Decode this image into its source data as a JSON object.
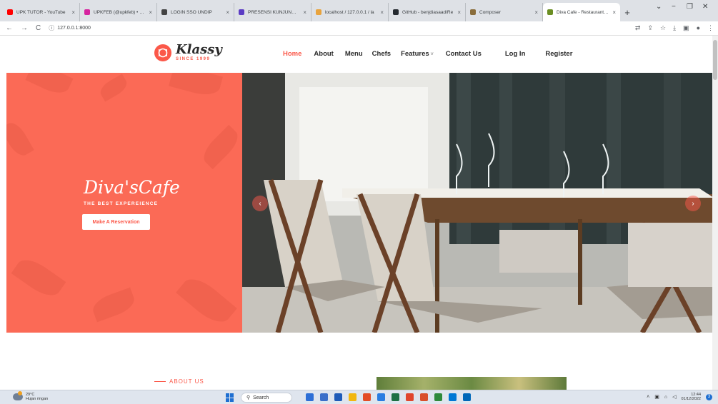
{
  "browser": {
    "tabs": [
      {
        "title": "UPK TUTOR - YouTube",
        "color": "#ff0000",
        "active": false
      },
      {
        "title": "UPKFEB (@upkfeb) • Foto",
        "color": "#d6249f",
        "active": false
      },
      {
        "title": "LOGIN SSO UNDIP",
        "color": "#444444",
        "active": false
      },
      {
        "title": "PRESENSI KUNJUNGAN",
        "color": "#5b3cc4",
        "active": false
      },
      {
        "title": "localhost / 127.0.0.1 / la",
        "color": "#e8a33d",
        "active": false
      },
      {
        "title": "GitHub - benjdiasaad/Re",
        "color": "#24292f",
        "active": false
      },
      {
        "title": "Composer",
        "color": "#8a6d3b",
        "active": false
      },
      {
        "title": "Diva Cafe - Restaurant HT",
        "color": "#6b8e23",
        "active": true
      }
    ],
    "new_tab": "+",
    "close_glyph": "×",
    "window_controls": {
      "dropdown": "⌄",
      "minimize": "−",
      "restore": "❐",
      "close": "✕"
    },
    "nav": {
      "back": "←",
      "forward": "→",
      "reload": "C",
      "info": "ⓘ"
    },
    "url": "127.0.0.1:8000",
    "right_icons": [
      "translate-icon",
      "share-icon",
      "star-icon",
      "download-icon",
      "sidebar-icon",
      "profile-icon",
      "menu-icon"
    ]
  },
  "site": {
    "logo": {
      "name": "Klassy",
      "since": "SINCE 1999"
    },
    "nav": [
      {
        "label": "Home",
        "active": true
      },
      {
        "label": "About",
        "active": false
      },
      {
        "label": "Menu",
        "active": false
      },
      {
        "label": "Chefs",
        "active": false
      },
      {
        "label": "Features",
        "active": false,
        "dropdown": true
      },
      {
        "label": "Contact Us",
        "active": false
      },
      {
        "label": "Log In",
        "active": false
      },
      {
        "label": "Register",
        "active": false
      }
    ],
    "hero": {
      "brand": "Diva'sCafe",
      "tagline": "THE BEST EXPEREIENCE",
      "cta": "Make A Reservation",
      "prev": "‹",
      "next": "›"
    },
    "about": {
      "label": "ABOUT US"
    }
  },
  "colors": {
    "accent": "#fb5849",
    "hero_bg": "#fb6a56"
  },
  "taskbar": {
    "weather": {
      "temp": "29°C",
      "desc": "Hujan ringan"
    },
    "search": "Search",
    "apps": [
      "#2d6fd6",
      "#3b6fc9",
      "#1e5bb8",
      "#f2b70f",
      "#e34c26",
      "#2a7de1",
      "#1d7044",
      "#e0462e",
      "#d94f2b",
      "#2f8a3c",
      "#0078d4",
      "#0067b8"
    ],
    "clock": {
      "time": "12:44",
      "date": "01/12/2022"
    },
    "notifications": "3"
  }
}
